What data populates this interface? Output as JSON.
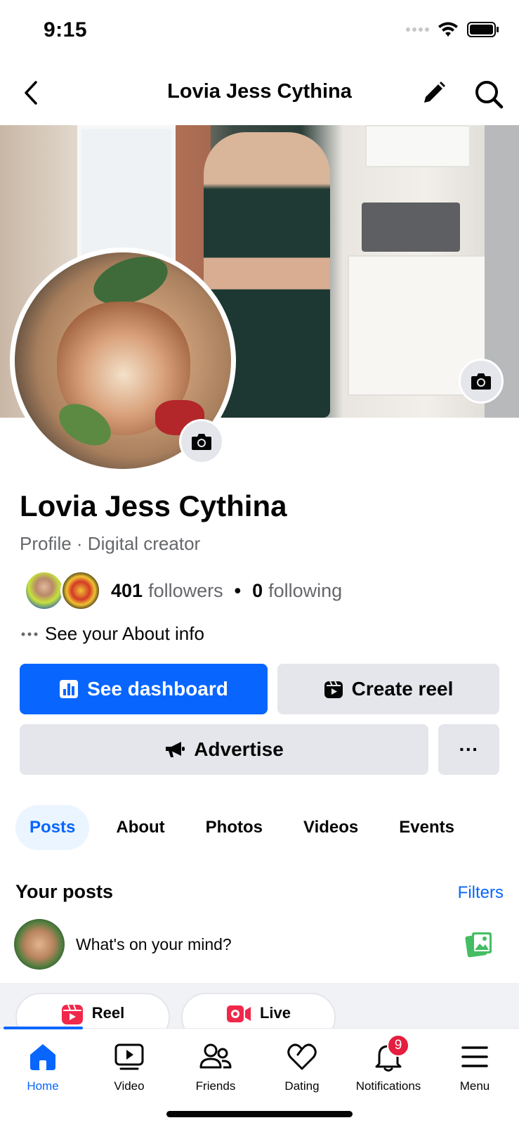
{
  "status": {
    "time": "9:15"
  },
  "nav": {
    "title": "Lovia Jess Cythina"
  },
  "profile": {
    "name": "Lovia Jess Cythina",
    "subtitle": "Profile · Digital creator",
    "followers_count": "401",
    "followers_label": "followers",
    "following_count": "0",
    "following_label": "following",
    "about_label": "See your About info"
  },
  "actions": {
    "dashboard": "See dashboard",
    "create_reel": "Create reel",
    "advertise": "Advertise",
    "more": "···"
  },
  "tabs": [
    "Posts",
    "About",
    "Photos",
    "Videos",
    "Events"
  ],
  "posts": {
    "heading": "Your posts",
    "filters": "Filters",
    "composer_placeholder": "What's on your mind?"
  },
  "quick_actions": {
    "reel": "Reel",
    "live": "Live"
  },
  "tab_bar": {
    "items": [
      "Home",
      "Video",
      "Friends",
      "Dating",
      "Notifications",
      "Menu"
    ],
    "notifications_badge": "9"
  },
  "colors": {
    "accent": "#0866ff",
    "badge": "#e41e3f",
    "button_gray": "#e4e6eb"
  }
}
